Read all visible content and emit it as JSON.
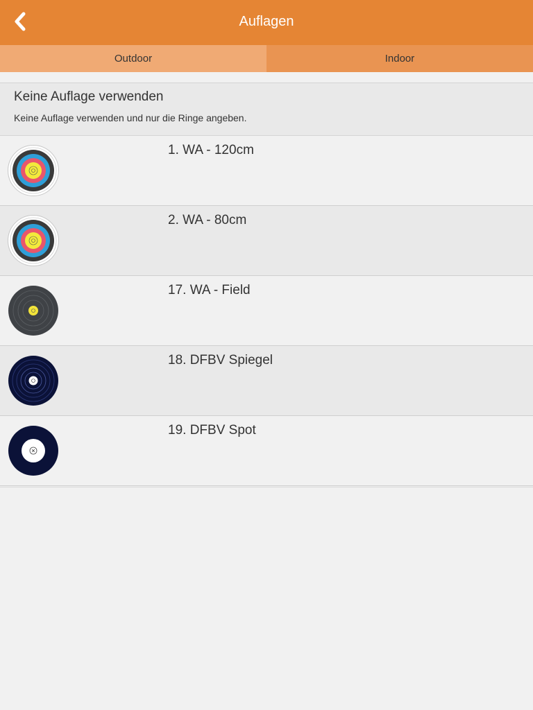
{
  "navbar": {
    "title": "Auflagen",
    "back_icon": "chevron-left-icon",
    "background": "#e58534"
  },
  "segments": {
    "items": [
      {
        "label": "Outdoor",
        "selected": true
      },
      {
        "label": "Indoor",
        "selected": false
      }
    ]
  },
  "no_target": {
    "title": "Keine Auflage verwenden",
    "subtitle": "Keine Auflage verwenden und nur die Ringe angeben."
  },
  "targets": [
    {
      "label": "1. WA - 120cm",
      "icon": "wa-target-icon"
    },
    {
      "label": "2. WA - 80cm",
      "icon": "wa-target-icon"
    },
    {
      "label": "17. WA - Field",
      "icon": "field-target-icon"
    },
    {
      "label": "18. DFBV Spiegel",
      "icon": "dfbv-spiegel-target-icon"
    },
    {
      "label": "19. DFBV Spot",
      "icon": "dfbv-spot-target-icon"
    }
  ]
}
